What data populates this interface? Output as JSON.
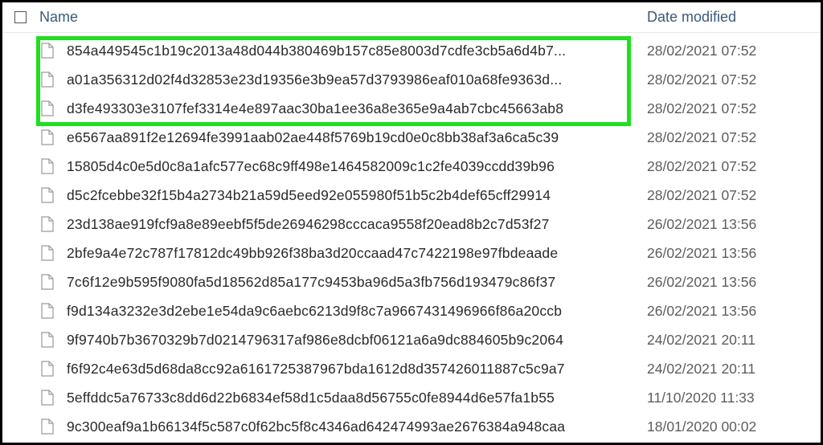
{
  "header": {
    "name_label": "Name",
    "date_label": "Date modified"
  },
  "files": [
    {
      "name": "854a449545c1b19c2013a48d044b380469b157c85e8003d7cdfe3cb5a6d4b7...",
      "date": "28/02/2021 07:52"
    },
    {
      "name": "a01a356312d02f4d32853e23d19356e3b9ea57d3793986eaf010a68fe9363d...",
      "date": "28/02/2021 07:52"
    },
    {
      "name": "d3fe493303e3107fef3314e4e897aac30ba1ee36a8e365e9a4ab7cbc45663ab8",
      "date": "28/02/2021 07:52"
    },
    {
      "name": "e6567aa891f2e12694fe3991aab02ae448f5769b19cd0e0c8bb38af3a6ca5c39",
      "date": "28/02/2021 07:52"
    },
    {
      "name": "15805d4c0e5d0c8a1afc577ec68c9ff498e1464582009c1c2fe4039ccdd39b96",
      "date": "28/02/2021 07:52"
    },
    {
      "name": "d5c2fcebbe32f15b4a2734b21a59d5eed92e055980f51b5c2b4def65cff29914",
      "date": "28/02/2021 07:52"
    },
    {
      "name": "23d138ae919fcf9a8e89eebf5f5de26946298cccaca9558f20ead8b2c7d53f27",
      "date": "26/02/2021 13:56"
    },
    {
      "name": "2bfe9a4e72c787f17812dc49bb926f38ba3d20ccaad47c7422198e97fbdeaade",
      "date": "26/02/2021 13:56"
    },
    {
      "name": "7c6f12e9b595f9080fa5d18562d85a177c9453ba96d5a3fb756d193479c86f37",
      "date": "26/02/2021 13:56"
    },
    {
      "name": "f9d134a3232e3d2ebe1e54da9c6aebc6213d9f8c7a9667431496966f86a20ccb",
      "date": "26/02/2021 13:56"
    },
    {
      "name": "9f9740b7b3670329b7d0214796317af986e8dcbf06121a6a9dc884605b9c2064",
      "date": "24/02/2021 20:11"
    },
    {
      "name": "f6f92c4e63d5d68da8cc92a6161725387967bda1612d8d357426011887c5c9a7",
      "date": "24/02/2021 20:11"
    },
    {
      "name": "5effddc5a76733c8dd6d22b6834ef58d1c5daa8d56755c0fe8944d6e57fa1b55",
      "date": "11/10/2020 11:33"
    },
    {
      "name": "9c300eaf9a1b66134f5c587c0f62bc5f8c4346ad642474993ae2676384a948caa",
      "date": "18/01/2020 00:02"
    }
  ],
  "highlighted_count": 3
}
